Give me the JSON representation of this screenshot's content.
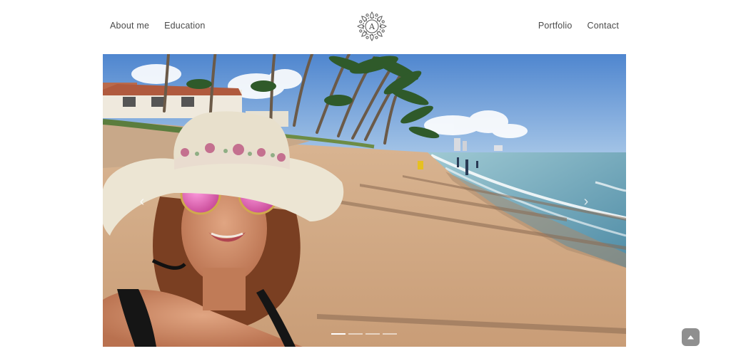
{
  "nav": {
    "left": [
      {
        "label": "About me"
      },
      {
        "label": "Education"
      }
    ],
    "right": [
      {
        "label": "Portfolio"
      },
      {
        "label": "Contact"
      }
    ],
    "logo": {
      "monogram": "A",
      "icon": "ornamental-mandala-logo"
    }
  },
  "carousel": {
    "slide_count": 4,
    "active_index": 0,
    "prev_icon": "chevron-left-icon",
    "next_icon": "chevron-right-icon",
    "prev_glyph": "‹",
    "next_glyph": "›"
  },
  "back_to_top": {
    "icon": "chevron-up-icon"
  },
  "colors": {
    "text": "#4a4a4a",
    "back_to_top_bg": "#8f8f8f",
    "sky": "#6f9fd6",
    "sand": "#cfa985",
    "sea": "#7bb3c4"
  }
}
